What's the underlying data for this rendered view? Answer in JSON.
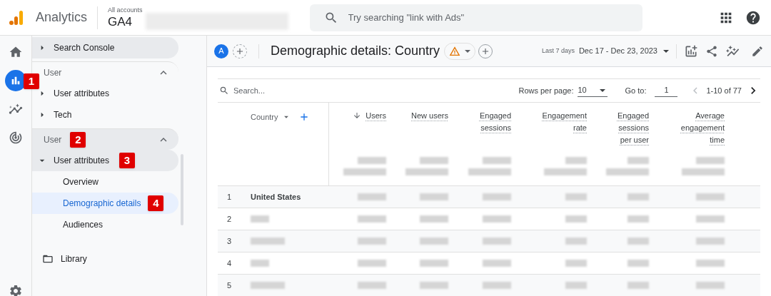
{
  "app": {
    "name": "Analytics",
    "account_label": "All accounts",
    "property": "GA4"
  },
  "search": {
    "placeholder": "Try searching \"link with Ads\""
  },
  "rail": [
    {
      "kind": "home",
      "selected": false
    },
    {
      "kind": "reports",
      "selected": true,
      "badge": "1"
    },
    {
      "kind": "explore",
      "selected": false
    },
    {
      "kind": "advertising",
      "selected": false
    },
    {
      "kind": "settings",
      "selected": false
    }
  ],
  "sidebar": [
    {
      "kind": "item",
      "label": "Search Console",
      "expanded": false,
      "hovered": true,
      "selected": false
    },
    {
      "kind": "section",
      "label": "User",
      "expanded": true,
      "hovered": false
    },
    {
      "kind": "item",
      "label": "User attributes",
      "expanded": false,
      "hovered": false,
      "selected": false
    },
    {
      "kind": "item",
      "label": "Tech",
      "expanded": false,
      "hovered": false,
      "selected": false
    },
    {
      "kind": "section",
      "label": "User",
      "expanded": true,
      "hovered": true,
      "badge": "2"
    },
    {
      "kind": "item",
      "label": "User attributes",
      "expanded": true,
      "hovered": true,
      "selected": false,
      "badge": "3"
    },
    {
      "kind": "sub",
      "label": "Overview",
      "selected": false
    },
    {
      "kind": "sub",
      "label": "Demographic details",
      "selected": true,
      "badge": "4"
    },
    {
      "kind": "sub",
      "label": "Audiences",
      "selected": false
    },
    {
      "kind": "library",
      "label": "Library"
    }
  ],
  "report": {
    "comparison": "A",
    "title": "Demographic details: Country",
    "warning": true,
    "date_label": "Last 7 days",
    "date_range": "Dec 17 - Dec 23, 2023"
  },
  "table": {
    "search_placeholder": "Search...",
    "rows_per_page_label": "Rows per page:",
    "rows_per_page": "10",
    "goto_label": "Go to:",
    "goto": "1",
    "range": "1-10 of 77",
    "columns": [
      {
        "kind": "dimension",
        "label": "Country"
      },
      {
        "kind": "metric",
        "label": "Users",
        "sorted": true
      },
      {
        "kind": "metric",
        "label": "New users",
        "sorted": false
      },
      {
        "kind": "metric",
        "label": "Engaged sessions",
        "sorted": false
      },
      {
        "kind": "metric",
        "label": "Engagement rate",
        "sorted": false
      },
      {
        "kind": "metric",
        "label": "Engaged sessions per user",
        "sorted": false
      },
      {
        "kind": "metric",
        "label": "Average engagement time",
        "sorted": false
      }
    ],
    "rows": [
      {
        "rank": "1",
        "country": "United States"
      },
      {
        "rank": "2"
      },
      {
        "rank": "3"
      },
      {
        "rank": "4"
      },
      {
        "rank": "5"
      }
    ]
  }
}
